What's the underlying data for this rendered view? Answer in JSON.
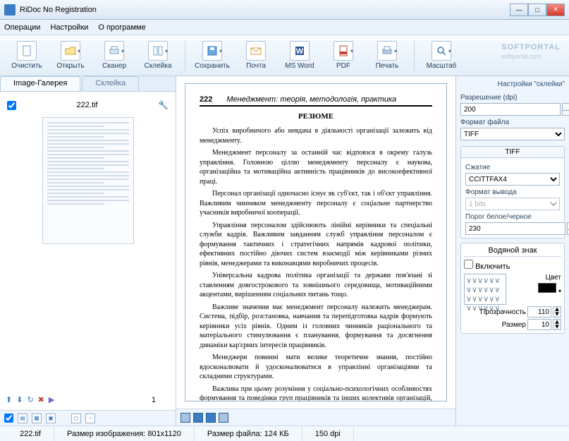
{
  "window": {
    "title": "RiDoc No Registration"
  },
  "menu": {
    "items": [
      "Операции",
      "Настройки",
      "О программе"
    ]
  },
  "toolbar": {
    "clear": "Очистить",
    "open": "Открыть",
    "scanner": "Сканер",
    "stitch": "Склейка",
    "save": "Сохранить",
    "mail": "Почта",
    "word": "MS Word",
    "pdf": "PDF",
    "print": "Печать",
    "zoom": "Масштаб",
    "watermark": "SOFTPORTAL",
    "watermark_sub": "softportal.com"
  },
  "left": {
    "tabs": {
      "gallery": "Image-Галерея",
      "stitch": "Склейка"
    },
    "file": "222.tif",
    "page_number": "1"
  },
  "document": {
    "page_no": "222",
    "header_title": "Менеджмент: теорія, методологія, практика",
    "heading": "РЕЗЮМЕ",
    "paragraphs": [
      "Успіх виробничого або невдача в діяльності організації залежить від менеджменту.",
      "Менеджмент персоналу за останній час відповзся в окрему галузь управління. Головною ціллю менеджменту персоналу є наукова, організаційна та мотиваційна активність працівників до високоефективної праці.",
      "Персонал організації одночасно існує як суб'єкт, так і об'єкт управління. Важливим чинником менеджменту персоналу є соціальне партнерство учасників виробничої кооперації.",
      "Управління персоналом здійснюють лінійні керівники та спеціальні служби кадрів. Важливим завданням служб управління персоналом є формування тактичних і стратегічних напрямів кадрової політики, ефективних постійно діючих систем взаємодії між керівниками різних рівнів, менеджерами та виконавцями виробничих процесів.",
      "Універсальна кадрова політика організації та держави пов'язані зі ставленням довгострокового та зовнішнього середовища, мотиваційними акцентами, вирішенням соціальних питань тощо.",
      "Важливе значення має менеджмент персоналу належить менеджерам. Система, підбір, розстановка, навчання та перепідготовка кадрів формують керівники усіх рівнів. Одним із головних чинників раціонального та матеріального стимулювання є планування, формування та досягнення динаміки кар'єрних інтересів працівників.",
      "Менеджери повинні мати велике теоретичне знання, постійно вдосконалювати й удосконалюватися в управлінні організаціями та складними структурами.",
      "Важлива при цьому розуміння у соціально-психологічних особливостях формування та поведінки груп працівників та інших колективів організацій, менталітет тощо."
    ]
  },
  "right": {
    "panel_title": "Настройки \"склейки\"",
    "labels": {
      "resolution": "Разрешение (dpi)",
      "file_format": "Формат файла",
      "compression": "Сжатие",
      "output_format": "Формат вывода",
      "threshold": "Порог белое/черное",
      "watermark": "Водяной знак",
      "enable": "Включить",
      "color": "Цвет",
      "opacity": "Прозрачность",
      "size": "Размер"
    },
    "values": {
      "resolution": "200",
      "file_format": "TIFF",
      "sub_tab": "TIFF",
      "compression": "CCITTFAX4",
      "output_format": "1 bits",
      "threshold": "230",
      "opacity": "110",
      "size": "10"
    }
  },
  "status": {
    "filename": "222.tif",
    "image_size_label": "Размер изображения:",
    "image_size": "801x1120",
    "file_size_label": "Размер файла:",
    "file_size": "124 КБ",
    "dpi": "150 dpi"
  }
}
